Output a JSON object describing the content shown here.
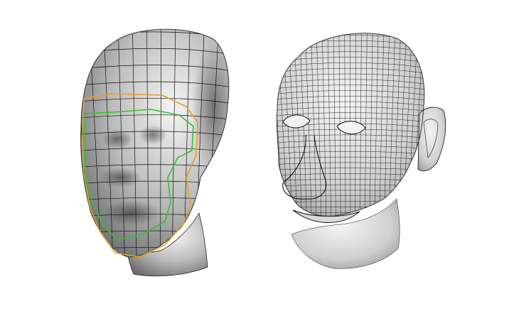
{
  "figure": {
    "background_color": "#ffffff",
    "mesh_color": "#111111",
    "shade_light": "#f4f4f4",
    "shade_mid": "#bcbcbc",
    "shade_dark": "#6e6e6e",
    "loop_outer_color": "#e6a126",
    "loop_inner_color": "#33c233"
  },
  "models": [
    {
      "name": "low-poly-head",
      "detail": "low",
      "has_edge_loops": true
    },
    {
      "name": "high-poly-head",
      "detail": "high",
      "has_edge_loops": false
    }
  ]
}
